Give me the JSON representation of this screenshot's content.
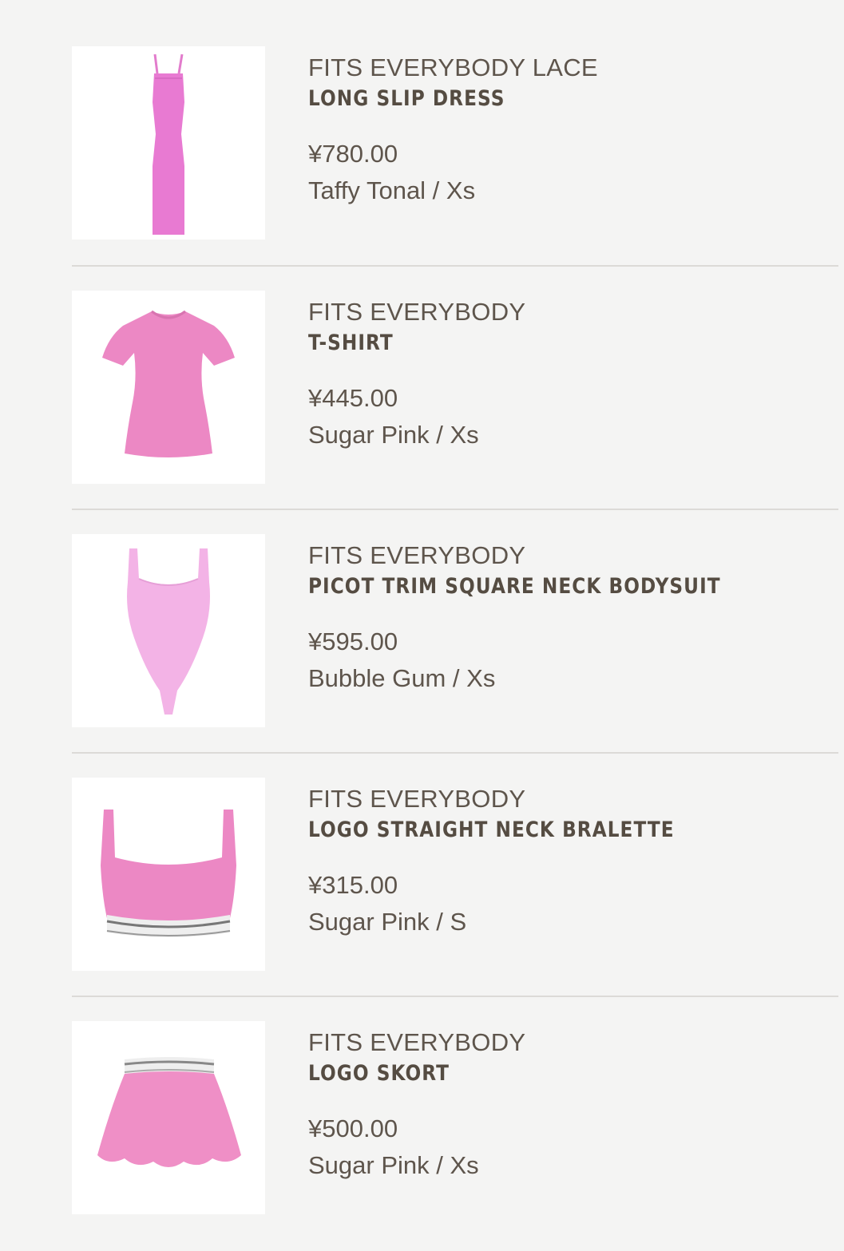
{
  "cart": {
    "items": [
      {
        "brand": "FITS EVERYBODY LACE",
        "name": "LONG SLIP DRESS",
        "price": "¥780.00",
        "variant": "Taffy Tonal / Xs",
        "image_icon": "pink-slip-dress-image",
        "color": "#e87ad2"
      },
      {
        "brand": "FITS EVERYBODY",
        "name": "T-SHIRT",
        "price": "¥445.00",
        "variant": "Sugar Pink / Xs",
        "image_icon": "pink-tshirt-image",
        "color": "#ec88c4"
      },
      {
        "brand": "FITS EVERYBODY",
        "name": "PICOT TRIM SQUARE NECK BODYSUIT",
        "price": "¥595.00",
        "variant": "Bubble Gum / Xs",
        "image_icon": "pink-bodysuit-image",
        "color": "#f3b3e6"
      },
      {
        "brand": "FITS EVERYBODY",
        "name": "LOGO STRAIGHT NECK BRALETTE",
        "price": "¥315.00",
        "variant": "Sugar Pink / S",
        "image_icon": "pink-bralette-image",
        "color": "#ec88c4"
      },
      {
        "brand": "FITS EVERYBODY",
        "name": "LOGO SKORT",
        "price": "¥500.00",
        "variant": "Sugar Pink / Xs",
        "image_icon": "pink-skort-image",
        "color": "#ef8fc6"
      }
    ]
  }
}
